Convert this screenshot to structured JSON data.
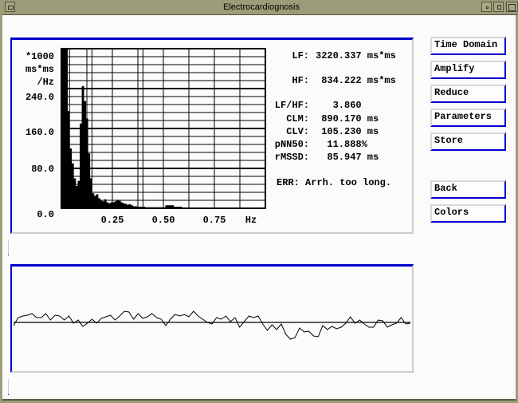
{
  "window": {
    "title": "Electrocardiognosis"
  },
  "results": [
    {
      "label": "LF:",
      "value": "3220.337 ms*ms"
    },
    {
      "label": "HF:",
      "value": " 834.222 ms*ms"
    },
    {
      "label": "LF/HF:",
      "value": "   3.860"
    },
    {
      "label": "CLM:",
      "value": " 890.170 ms"
    },
    {
      "label": "CLV:",
      "value": " 105.230 ms"
    },
    {
      "label": "pNN50:",
      "value": "  11.888%"
    },
    {
      "label": "rMSSD:",
      "value": "  85.947 ms"
    }
  ],
  "error": "ERR: Arrh. too long.",
  "buttons": [
    "Time Domain",
    "Amplify",
    "Reduce",
    "Parameters",
    "Store",
    "Back",
    "Colors"
  ],
  "colors": {
    "accent": "#0000cc",
    "titlebar": "#9c9c78",
    "bars": "#000000"
  },
  "chart_data": [
    {
      "type": "bar",
      "ylabel_lines": [
        "*1000",
        "ms*ms",
        "/Hz"
      ],
      "xunit": "Hz",
      "ylim": [
        0,
        320
      ],
      "xlim": [
        0,
        1.0
      ],
      "yticks": [
        {
          "v": 240,
          "label": "240.0"
        },
        {
          "v": 160,
          "label": "160.0"
        },
        {
          "v": 80,
          "label": "80.0"
        },
        {
          "v": 0,
          "label": "0.0"
        }
      ],
      "xticks": [
        {
          "v": 0.25,
          "label": "0.25"
        },
        {
          "v": 0.5,
          "label": "0.50"
        },
        {
          "v": 0.75,
          "label": "0.75"
        }
      ],
      "band_lines_hz": [
        0.04,
        0.15,
        0.4
      ],
      "grid": true,
      "bin_width_hz": 0.01,
      "values": [
        330,
        330,
        330,
        195,
        120,
        90,
        60,
        45,
        55,
        170,
        245,
        215,
        180,
        110,
        60,
        30,
        25,
        28,
        20,
        15,
        14,
        18,
        12,
        10,
        12,
        12,
        14,
        17,
        15,
        12,
        10,
        9,
        7,
        8,
        6,
        4,
        4,
        3,
        3,
        3,
        3,
        2,
        2,
        2,
        2,
        2,
        2,
        2,
        2,
        2,
        2,
        6,
        6,
        6,
        6,
        3,
        3,
        3,
        3
      ]
    },
    {
      "type": "line",
      "values": [
        -4,
        6,
        8,
        9,
        11,
        6,
        6,
        11,
        3,
        9,
        8,
        3,
        8,
        -1,
        3,
        -5,
        -1,
        4,
        -1,
        5,
        7,
        9,
        3,
        8,
        14,
        13,
        4,
        11,
        5,
        7,
        11,
        6,
        4,
        -4,
        4,
        10,
        8,
        10,
        7,
        14,
        8,
        4,
        0,
        -2,
        6,
        4,
        8,
        1,
        6,
        -6,
        1,
        8,
        6,
        8,
        -2,
        -10,
        -3,
        -9,
        -2,
        -15,
        -21,
        -19,
        -7,
        -12,
        -11,
        -17,
        -18,
        -4,
        -9,
        -5,
        -8,
        -6,
        -1,
        7,
        -1,
        3,
        -2,
        -6,
        -6,
        3,
        2,
        -6,
        -3,
        -1,
        6,
        -2,
        -1
      ]
    }
  ]
}
